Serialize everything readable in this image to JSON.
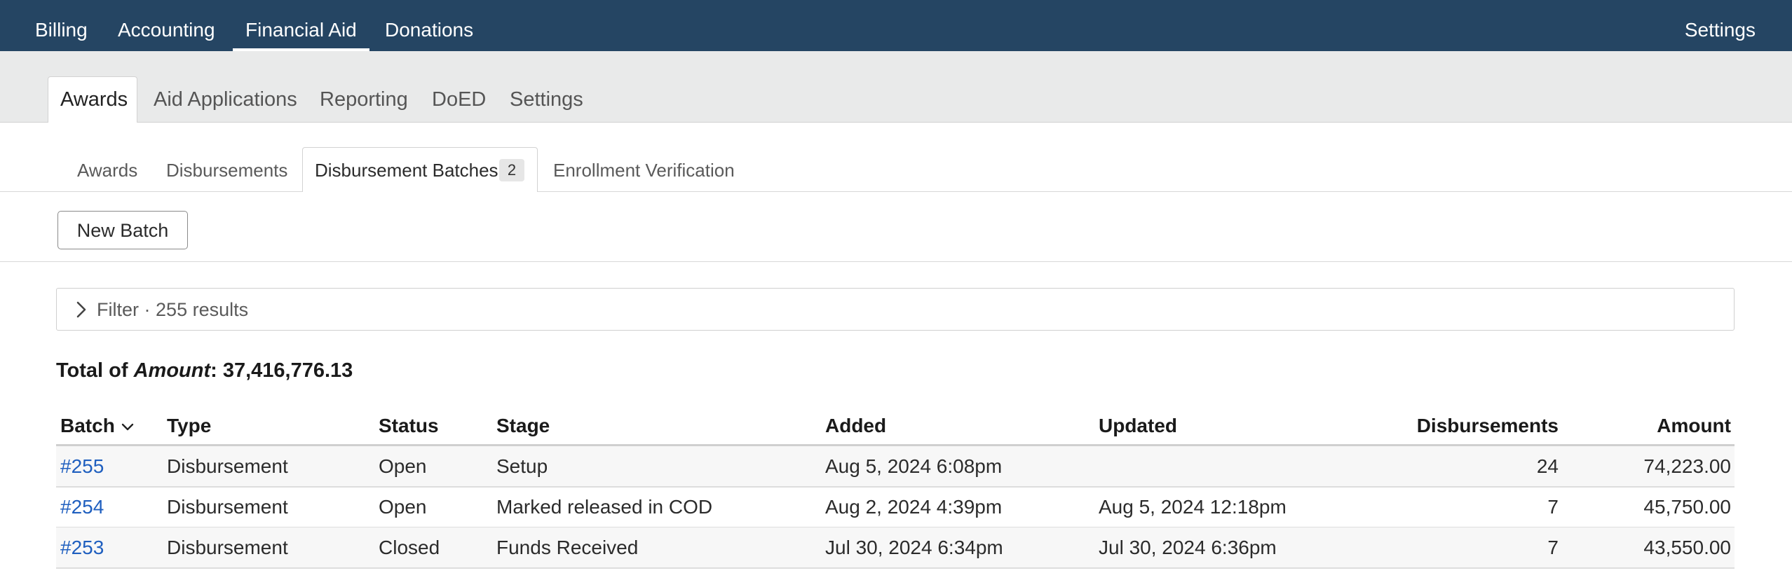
{
  "topnav": {
    "items": [
      {
        "label": "Billing"
      },
      {
        "label": "Accounting"
      },
      {
        "label": "Financial Aid"
      },
      {
        "label": "Donations"
      }
    ],
    "active": "Financial Aid",
    "settings_label": "Settings"
  },
  "secnav": {
    "active_label": "Awards",
    "items": [
      {
        "label": "Aid Applications"
      },
      {
        "label": "Reporting"
      },
      {
        "label": "DoED"
      },
      {
        "label": "Settings"
      }
    ]
  },
  "tertnav": {
    "items": [
      {
        "label": "Awards"
      },
      {
        "label": "Disbursements"
      },
      {
        "label": "Enrollment Verification"
      }
    ],
    "active_label": "Disbursement Batches",
    "active_badge": "2"
  },
  "actions": {
    "new_batch_label": "New Batch"
  },
  "filter": {
    "label": "Filter",
    "separator": "·",
    "results": "255 results"
  },
  "total": {
    "prefix": "Total of ",
    "field": "Amount",
    "value": ": 37,416,776.13"
  },
  "table": {
    "columns": {
      "batch": "Batch",
      "type": "Type",
      "status": "Status",
      "stage": "Stage",
      "added": "Added",
      "updated": "Updated",
      "disbursements": "Disbursements",
      "amount": "Amount"
    },
    "sort_icon": "chevron-down-icon",
    "rows": [
      {
        "batch": "#255",
        "type": "Disbursement",
        "status": "Open",
        "stage": "Setup",
        "added": "Aug 5, 2024 6:08pm",
        "updated": "",
        "disbursements": "24",
        "amount": "74,223.00"
      },
      {
        "batch": "#254",
        "type": "Disbursement",
        "status": "Open",
        "stage": "Marked released in COD",
        "added": "Aug 2, 2024 4:39pm",
        "updated": "Aug 5, 2024 12:18pm",
        "disbursements": "7",
        "amount": "45,750.00"
      },
      {
        "batch": "#253",
        "type": "Disbursement",
        "status": "Closed",
        "stage": "Funds Received",
        "added": "Jul 30, 2024 6:34pm",
        "updated": "Jul 30, 2024 6:36pm",
        "disbursements": "7",
        "amount": "43,550.00"
      }
    ]
  },
  "colors": {
    "topbar": "#254563",
    "link": "#1f5fbf",
    "secbar": "#e9eaea"
  }
}
